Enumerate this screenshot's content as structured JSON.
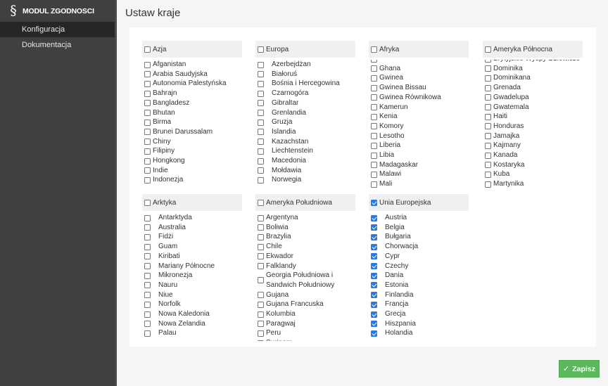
{
  "sidebar": {
    "brand_icon": "§",
    "brand_name": "MODUL ZGODNOSCI",
    "items": [
      {
        "label": "Konfiguracja",
        "active": true
      },
      {
        "label": "Dokumentacja",
        "active": false
      }
    ]
  },
  "page": {
    "title": "Ustaw kraje"
  },
  "groups": [
    {
      "name": "Azja",
      "checked": false,
      "indent": false,
      "scroll_offset": 0,
      "items": [
        {
          "label": "Afganistan",
          "checked": false
        },
        {
          "label": "Arabia Saudyjska",
          "checked": false
        },
        {
          "label": "Autonomia Palestyńska",
          "checked": false
        },
        {
          "label": "Bahrajn",
          "checked": false
        },
        {
          "label": "Bangladesz",
          "checked": false
        },
        {
          "label": "Bhutan",
          "checked": false
        },
        {
          "label": "Birma",
          "checked": false
        },
        {
          "label": "Brunei Darussalam",
          "checked": false
        },
        {
          "label": "Chiny",
          "checked": false
        },
        {
          "label": "Filipiny",
          "checked": false
        },
        {
          "label": "Hongkong",
          "checked": false
        },
        {
          "label": "Indie",
          "checked": false
        },
        {
          "label": "Indonezja",
          "checked": false
        }
      ]
    },
    {
      "name": "Europa",
      "checked": false,
      "indent": true,
      "scroll_offset": 0,
      "items": [
        {
          "label": "Azerbejdżan",
          "checked": false
        },
        {
          "label": "Białoruś",
          "checked": false
        },
        {
          "label": "Bośnia i Hercegowina",
          "checked": false
        },
        {
          "label": "Czarnogóra",
          "checked": false
        },
        {
          "label": "Gibraltar",
          "checked": false
        },
        {
          "label": "Grenlandia",
          "checked": false
        },
        {
          "label": "Gruzja",
          "checked": false
        },
        {
          "label": "Islandia",
          "checked": false
        },
        {
          "label": "Kazachstan",
          "checked": false
        },
        {
          "label": "Liechtenstein",
          "checked": false
        },
        {
          "label": "Macedonia",
          "checked": false
        },
        {
          "label": "Mołdawia",
          "checked": false
        },
        {
          "label": "Norwegia",
          "checked": false
        }
      ]
    },
    {
      "name": "Afryka",
      "checked": false,
      "indent": false,
      "scroll_offset": 1,
      "items": [
        {
          "label": "",
          "checked": false
        },
        {
          "label": "Ghana",
          "checked": false
        },
        {
          "label": "Gwinea",
          "checked": false
        },
        {
          "label": "Gwinea Bissau",
          "checked": false
        },
        {
          "label": "Gwinea Równikowa",
          "checked": false
        },
        {
          "label": "Kamerun",
          "checked": false
        },
        {
          "label": "Kenia",
          "checked": false
        },
        {
          "label": "Komory",
          "checked": false
        },
        {
          "label": "Lesotho",
          "checked": false
        },
        {
          "label": "Liberia",
          "checked": false
        },
        {
          "label": "Libia",
          "checked": false
        },
        {
          "label": "Madagaskar",
          "checked": false
        },
        {
          "label": "Malawi",
          "checked": false
        },
        {
          "label": "Mali",
          "checked": false
        }
      ]
    },
    {
      "name": "Ameryka Północna",
      "checked": false,
      "indent": false,
      "scroll_offset": 1,
      "items": [
        {
          "label": "Brytyjskie Wyspy Dziewicze",
          "checked": false
        },
        {
          "label": "Dominika",
          "checked": false
        },
        {
          "label": "Dominikana",
          "checked": false
        },
        {
          "label": "Grenada",
          "checked": false
        },
        {
          "label": "Gwadelupa",
          "checked": false
        },
        {
          "label": "Gwatemala",
          "checked": false
        },
        {
          "label": "Haiti",
          "checked": false
        },
        {
          "label": "Honduras",
          "checked": false
        },
        {
          "label": "Jamajka",
          "checked": false
        },
        {
          "label": "Kajmany",
          "checked": false
        },
        {
          "label": "Kanada",
          "checked": false
        },
        {
          "label": "Kostaryka",
          "checked": false
        },
        {
          "label": "Kuba",
          "checked": false
        },
        {
          "label": "Martynika",
          "checked": false
        }
      ]
    },
    {
      "name": "Arktyka",
      "checked": false,
      "indent": true,
      "scroll_offset": 0,
      "items": [
        {
          "label": "Antarktyda",
          "checked": false
        },
        {
          "label": "Australia",
          "checked": false
        },
        {
          "label": "Fidżi",
          "checked": false
        },
        {
          "label": "Guam",
          "checked": false
        },
        {
          "label": "Kiribati",
          "checked": false
        },
        {
          "label": "Mariany Północne",
          "checked": false
        },
        {
          "label": "Mikronezja",
          "checked": false
        },
        {
          "label": "Nauru",
          "checked": false
        },
        {
          "label": "Niue",
          "checked": false
        },
        {
          "label": "Norfolk",
          "checked": false
        },
        {
          "label": "Nowa Kaledonia",
          "checked": false
        },
        {
          "label": "Nowa Zelandia",
          "checked": false
        },
        {
          "label": "Palau",
          "checked": false
        }
      ]
    },
    {
      "name": "Ameryka Południowa",
      "checked": false,
      "indent": false,
      "scroll_offset": 0,
      "items": [
        {
          "label": "Argentyna",
          "checked": false
        },
        {
          "label": "Boliwia",
          "checked": false
        },
        {
          "label": "Brazylia",
          "checked": false
        },
        {
          "label": "Chile",
          "checked": false
        },
        {
          "label": "Ekwador",
          "checked": false
        },
        {
          "label": "Falklandy",
          "checked": false
        },
        {
          "label": "Georgia Południowa i Sandwich Południowy",
          "checked": false
        },
        {
          "label": "Gujana",
          "checked": false
        },
        {
          "label": "Gujana Francuska",
          "checked": false
        },
        {
          "label": "Kolumbia",
          "checked": false
        },
        {
          "label": "Paragwaj",
          "checked": false
        },
        {
          "label": "Peru",
          "checked": false
        },
        {
          "label": "Surinam",
          "checked": false
        }
      ]
    },
    {
      "name": "Unia Europejska",
      "checked": true,
      "indent": true,
      "scroll_offset": 0,
      "items": [
        {
          "label": "Austria",
          "checked": true
        },
        {
          "label": "Belgia",
          "checked": true
        },
        {
          "label": "Bułgaria",
          "checked": true
        },
        {
          "label": "Chorwacja",
          "checked": true
        },
        {
          "label": "Cypr",
          "checked": true
        },
        {
          "label": "Czechy",
          "checked": true
        },
        {
          "label": "Dania",
          "checked": true
        },
        {
          "label": "Estonia",
          "checked": true
        },
        {
          "label": "Finlandia",
          "checked": true
        },
        {
          "label": "Francja",
          "checked": true
        },
        {
          "label": "Grecja",
          "checked": true
        },
        {
          "label": "Hiszpania",
          "checked": true
        },
        {
          "label": "Holandia",
          "checked": true
        }
      ]
    }
  ],
  "save_button": {
    "icon": "check-icon",
    "label": "Zapisz"
  },
  "colors": {
    "accent_checkbox": "#2a7ae2",
    "save_green": "#5cb85c",
    "sidebar_bg": "#404040"
  }
}
